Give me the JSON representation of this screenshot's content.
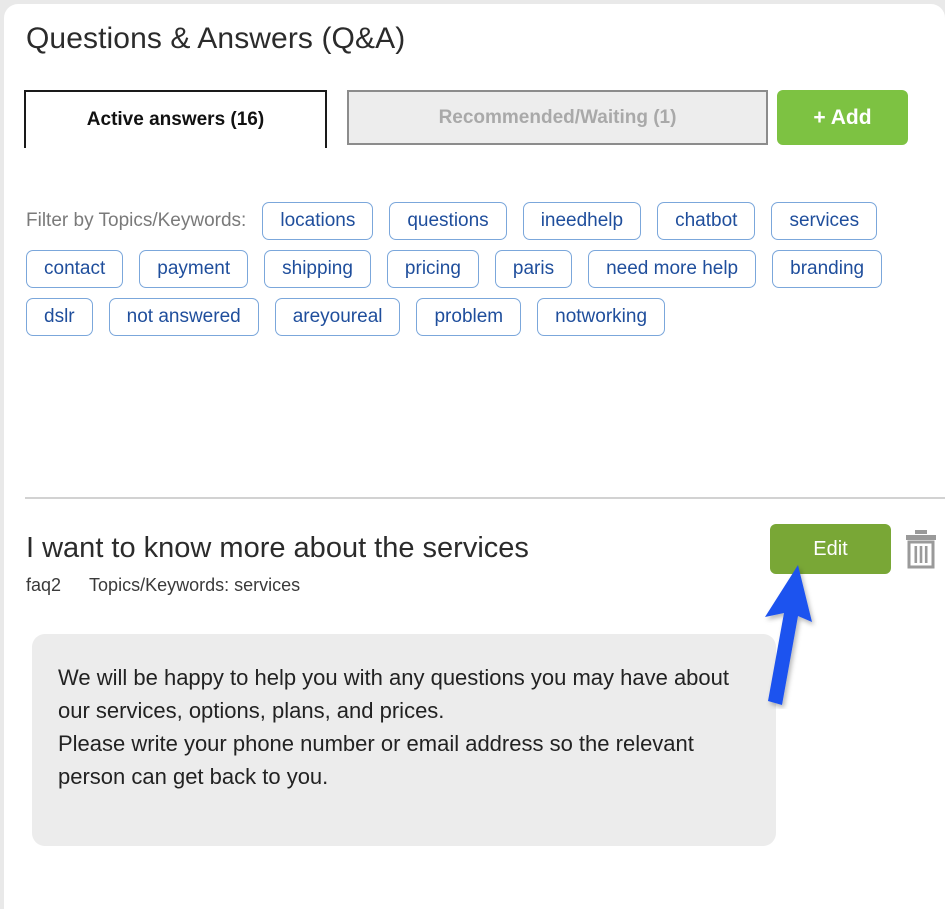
{
  "page": {
    "title": "Questions & Answers (Q&A)"
  },
  "tabs": [
    {
      "label": "Active answers (16)",
      "active": true
    },
    {
      "label": "Recommended/Waiting (1)",
      "active": false
    }
  ],
  "toolbar": {
    "add_label": "+ Add",
    "add_color": "#7dc242"
  },
  "filter": {
    "label": "Filter by Topics/Keywords:",
    "tags": [
      "locations",
      "questions",
      "ineedhelp",
      "chatbot",
      "services",
      "contact",
      "payment",
      "shipping",
      "pricing",
      "paris",
      "need more help",
      "branding",
      "dslr",
      "not answered",
      "areyoureal",
      "problem",
      "notworking"
    ],
    "tag_border_color": "#7ba7db",
    "tag_text_color": "#1f4e9c"
  },
  "qa_item": {
    "question": "I want to know more about the services",
    "id": "faq2",
    "keywords_label": "Topics/Keywords: services",
    "edit_label": "Edit",
    "edit_color": "#79a736",
    "delete_icon": "trash-icon",
    "answer": "We will be happy to help you with any questions you may have about our services, options, plans, and prices.\nPlease write your phone number or email address so the relevant person can get back to you."
  },
  "annotation": {
    "type": "arrow",
    "color": "#1f52ef",
    "points_at": "Edit"
  }
}
